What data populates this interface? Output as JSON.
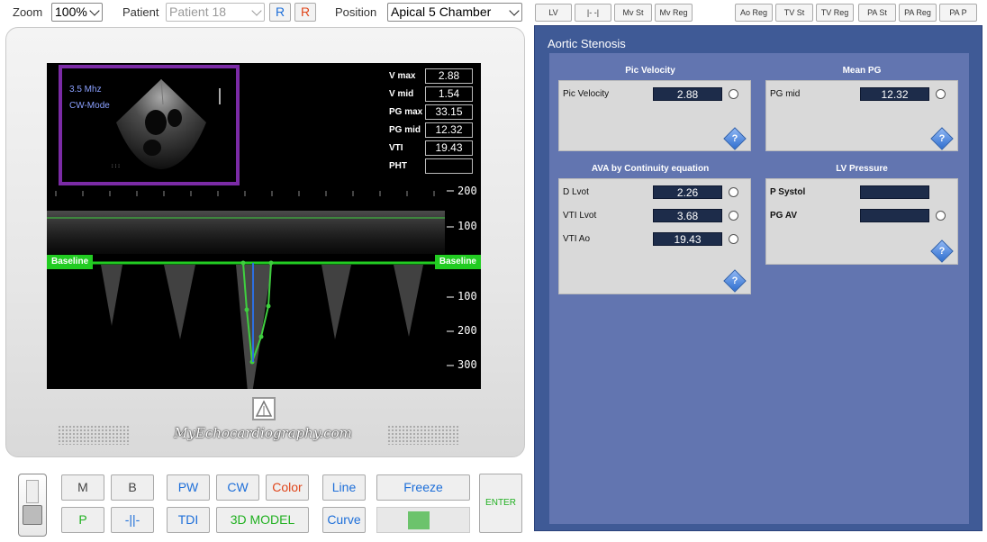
{
  "topbar": {
    "zoom_label": "Zoom",
    "zoom_value": "100%",
    "patient_label": "Patient",
    "patient_value": "Patient 18",
    "r1": "R",
    "r2": "R",
    "position_label": "Position",
    "position_value": "Apical 5 Chamber"
  },
  "mode_buttons": [
    "LV",
    "|- -|",
    "Mv St",
    "Mv Reg",
    "Ao Reg",
    "TV St",
    "TV Reg",
    "PA St",
    "PA Reg",
    "PA P"
  ],
  "screen": {
    "freq": "3.5 Mhz",
    "mode": "CW-Mode",
    "measurements": [
      {
        "label": "V max",
        "value": "2.88"
      },
      {
        "label": "V mid",
        "value": "1.54"
      },
      {
        "label": "PG max",
        "value": "33.15"
      },
      {
        "label": "PG mid",
        "value": "12.32"
      },
      {
        "label": "VTI",
        "value": "19.43"
      },
      {
        "label": "PHT",
        "value": ""
      }
    ],
    "baseline_left": "Baseline",
    "baseline_right": "Baseline",
    "scale": [
      "200",
      "100",
      "100",
      "200",
      "300"
    ]
  },
  "brand": "MyEchocardiography.com",
  "controls": {
    "m": "M",
    "b": "B",
    "pw": "PW",
    "cw": "CW",
    "color": "Color",
    "line": "Line",
    "freeze": "Freeze",
    "p": "P",
    "bar": "-||-",
    "tdi": "TDI",
    "model3d": "3D MODEL",
    "curve": "Curve",
    "enter": "ENTER"
  },
  "panel": {
    "title": "Aortic Stenosis",
    "peak": {
      "title": "Pic Velocity",
      "label": "Pic Velocity",
      "value": "2.88"
    },
    "mean": {
      "title": "Mean PG",
      "label": "PG mid",
      "value": "12.32"
    },
    "ava": {
      "title": "AVA by Continuity equation",
      "rows": [
        {
          "label": "D Lvot",
          "value": "2.26"
        },
        {
          "label": "VTI Lvot",
          "value": "3.68"
        },
        {
          "label": "VTI Ao",
          "value": "19.43"
        }
      ]
    },
    "lvp": {
      "title": "LV Pressure",
      "rows": [
        {
          "label": "P Systol",
          "value": ""
        },
        {
          "label": "PG AV",
          "value": ""
        }
      ]
    },
    "help": "?"
  }
}
